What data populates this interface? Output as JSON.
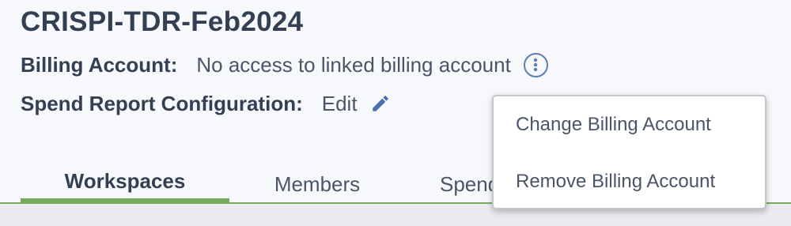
{
  "project": {
    "title": "CRISPI-TDR-Feb2024"
  },
  "billing": {
    "label": "Billing Account:",
    "value": "No access to linked billing account",
    "info_icon": "info-icon"
  },
  "spend_report": {
    "label": "Spend Report Configuration:",
    "edit_label": "Edit",
    "edit_icon": "pencil-icon"
  },
  "tabs": [
    {
      "label": "Workspaces",
      "active": true
    },
    {
      "label": "Members",
      "active": false
    },
    {
      "label": "Spend report",
      "active": false
    }
  ],
  "billing_menu": {
    "items": [
      {
        "label": "Change Billing Account"
      },
      {
        "label": "Remove Billing Account"
      }
    ]
  },
  "colors": {
    "accent_green": "#74ad5a",
    "icon_blue": "#5b7fb3",
    "text_dark": "#333f52"
  }
}
